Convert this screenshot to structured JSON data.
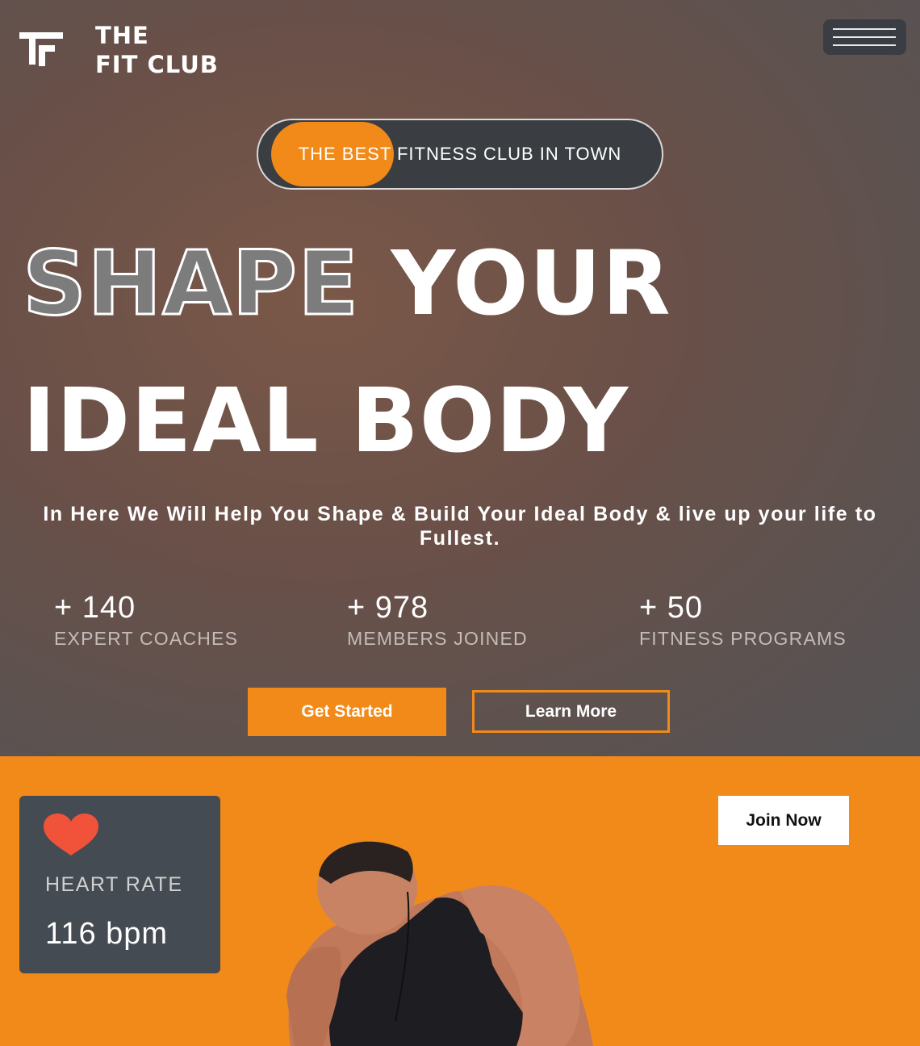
{
  "brand": {
    "line1": "THE",
    "line2": "FIT CLUB"
  },
  "nav": {
    "menu_icon": "hamburger-menu-icon"
  },
  "hero": {
    "tagline": "THE BEST FITNESS CLUB IN TOWN",
    "headline_outline": "SHAPE",
    "headline_rest": "YOUR",
    "headline_line2": "IDEAL BODY",
    "subtitle": "In Here We Will Help You Shape & Build Your Ideal Body & live up your life to Fullest.",
    "stats": [
      {
        "value": "+ 140",
        "label": "EXPERT COACHES"
      },
      {
        "value": "+ 978",
        "label": "MEMBERS JOINED"
      },
      {
        "value": "+ 50",
        "label": "FITNESS PROGRAMS"
      }
    ],
    "primary_button": "Get Started",
    "secondary_button": "Learn More"
  },
  "side": {
    "join_button": "Join Now",
    "heart_card": {
      "icon": "heart-icon",
      "label": "HEART RATE",
      "value": "116 bpm"
    },
    "image": "athlete-photo"
  },
  "colors": {
    "accent": "#f28a1a",
    "card": "#454b52",
    "heart": "#f0533a"
  }
}
